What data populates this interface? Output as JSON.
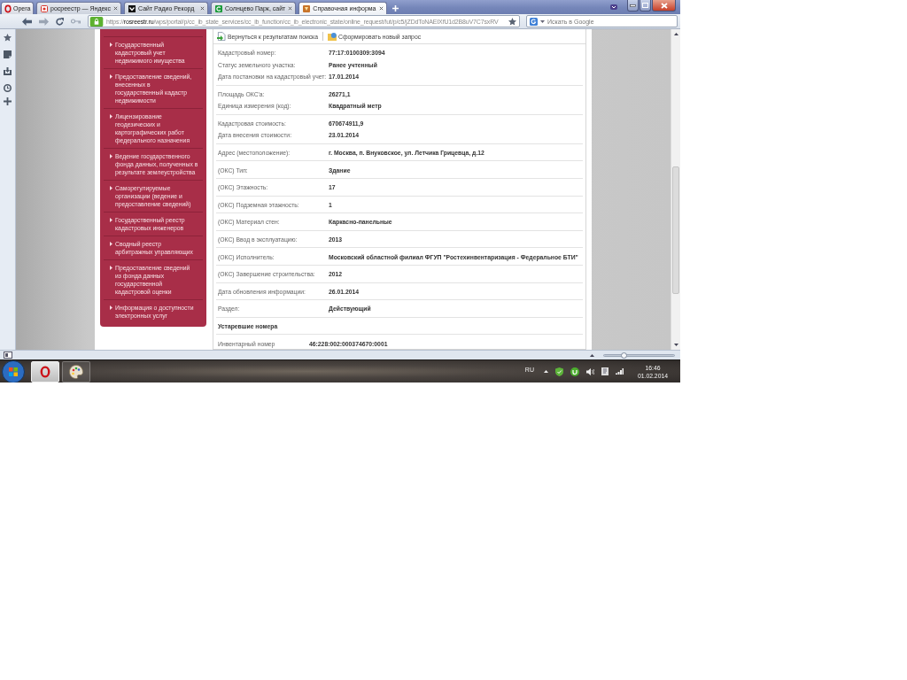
{
  "browser": {
    "menu_button": "Opera",
    "tabs": [
      {
        "title": "росреестр — Яндекс",
        "selected": false
      },
      {
        "title": "Сайт Радио Рекорд",
        "selected": false
      },
      {
        "title": "Солнцево Парк, сайт",
        "selected": false
      },
      {
        "title": "Справочная информа",
        "selected": true
      }
    ],
    "address": {
      "scheme": "https://",
      "host": "rosreestr.ru",
      "path": "/wps/portal/p/cc_ib_state_services/cc_ib_function/cc_ib_electronic_state/online_request/!ut/p/c5/jZDdToNAEIXfU1d2B8uV7C7sxRV"
    },
    "search": {
      "placeholder": "Искать в Google"
    }
  },
  "side_menu": {
    "items": [
      "Государственный\nкадастровый учет\nнедвижимого имущества",
      "Предоставление сведений,\nвнесенных в\nгосударственный кадастр\nнедвижимости",
      "Лицензирование\nгеодезических и\nкартографических работ\nфедерального назначения",
      "Ведение государственного\nфонда данных, полученных в\nрезультате землеустройства",
      "Саморегулируемые\nорганизации (ведение и\nпредоставление сведений)",
      "Государственный реестр\nкадастровых инженеров",
      "Сводный реестр\nарбитражных управляющих",
      "Предоставление сведений\nиз фонда данных\nгосударственной\nкадастровой оценки",
      "Информация о доступности\nэлектронных услуг"
    ]
  },
  "toolbar": {
    "links": [
      "Вернуться к результатам поиска",
      "Сформировать новый запрос"
    ]
  },
  "details": {
    "groups": [
      {
        "rows": [
          {
            "label": "Кадастровый номер:",
            "value": "77:17:0100309:3094"
          },
          {
            "label": "Статус земельного участка:",
            "value": "Ранее учтенный"
          },
          {
            "label": "Дата постановки на кадастровый учет:",
            "value": "17.01.2014"
          }
        ]
      },
      {
        "rows": [
          {
            "label": "Площадь ОКС'а:",
            "value": "26271,1"
          },
          {
            "label": "Единица измерения (код):",
            "value": "Квадратный метр"
          }
        ]
      },
      {
        "rows": [
          {
            "label": "Кадастровая стоимость:",
            "value": "670674911,9"
          },
          {
            "label": "Дата внесения стоимости:",
            "value": "23.01.2014"
          }
        ]
      },
      {
        "rows": [
          {
            "label": "Адрес (местоположение):",
            "value": "г. Москва, п. Внуковское, ул. Летчика Грицевца, д.12"
          }
        ]
      },
      {
        "rows": [
          {
            "label": "(ОКС) Тип:",
            "value": "Здание"
          }
        ]
      },
      {
        "rows": [
          {
            "label": "(ОКС) Этажность:",
            "value": "17"
          }
        ]
      },
      {
        "rows": [
          {
            "label": "(ОКС) Подземная этажность:",
            "value": "1"
          }
        ]
      },
      {
        "rows": [
          {
            "label": "(ОКС) Материал стен:",
            "value": "Каркасно-панельные"
          }
        ]
      },
      {
        "rows": [
          {
            "label": "(ОКС) Ввод в эксплуатацию:",
            "value": "2013"
          }
        ]
      },
      {
        "rows": [
          {
            "label": "(ОКС) Исполнитель:",
            "value": "Московский областной филиал ФГУП \"Ростехинвентаризация - Федеральное БТИ\""
          }
        ]
      },
      {
        "rows": [
          {
            "label": "(ОКС) Завершение строительства:",
            "value": "2012"
          }
        ]
      },
      {
        "rows": [
          {
            "label": "Дата обновления информации:",
            "value": "26.01.2014"
          }
        ]
      },
      {
        "rows": [
          {
            "label": "Раздел:",
            "value": "Действующий"
          }
        ]
      }
    ]
  },
  "obsolete_numbers": {
    "title": "Устаревшие номера",
    "rows": [
      {
        "label": "Инвентарный номер",
        "value": "46:228:002:000374670:0001"
      }
    ]
  },
  "status_bar": {
    "zoom": {
      "level": 0.28
    }
  },
  "taskbar": {
    "apps": [
      {
        "selected": true
      },
      {
        "selected": false
      }
    ],
    "language": "RU",
    "time": "16:46",
    "date": "01.02.2014"
  }
}
